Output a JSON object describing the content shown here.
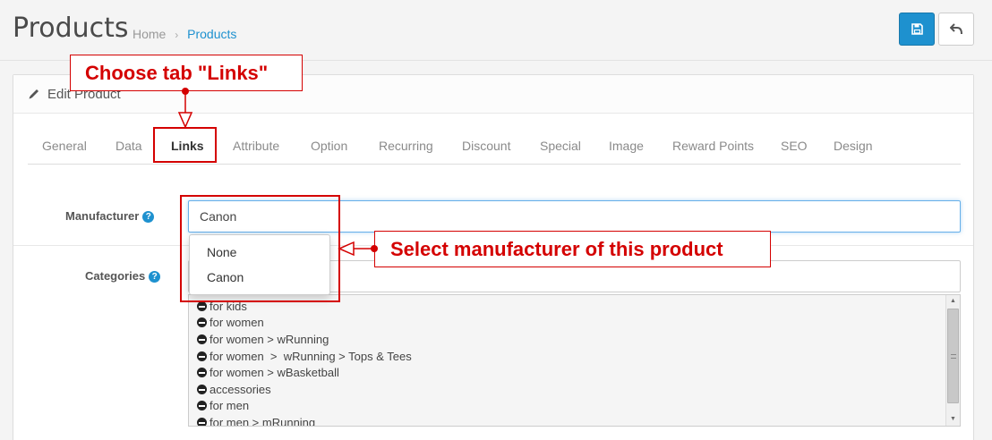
{
  "header": {
    "title": "Products",
    "breadcrumb": {
      "home": "Home",
      "separator": "›",
      "current": "Products"
    }
  },
  "panel": {
    "title": "Edit Product"
  },
  "tabs": [
    {
      "label": "General"
    },
    {
      "label": "Data"
    },
    {
      "label": "Links",
      "active": true
    },
    {
      "label": "Attribute"
    },
    {
      "label": "Option"
    },
    {
      "label": "Recurring"
    },
    {
      "label": "Discount"
    },
    {
      "label": "Special"
    },
    {
      "label": "Image"
    },
    {
      "label": "Reward Points"
    },
    {
      "label": "SEO"
    },
    {
      "label": "Design"
    }
  ],
  "form": {
    "manufacturer": {
      "label": "Manufacturer",
      "value": "Canon",
      "help": "?"
    },
    "categories": {
      "label": "Categories",
      "help": "?"
    },
    "manufacturer_options": [
      "None",
      "Canon"
    ],
    "category_items": [
      "for kids",
      "for women",
      "for women > wRunning",
      "for women  >  wRunning > Tops & Tees",
      "for women > wBasketball",
      "accessories",
      "for men",
      "for men > mRunning"
    ]
  },
  "annotations": {
    "choose_tab": "Choose tab \"Links\"",
    "select_manufacturer": "Select manufacturer of this product"
  },
  "colors": {
    "primary": "#1e91cf",
    "annotation_red": "#d40000"
  },
  "icons": {
    "save": "save-icon",
    "back": "reply-icon",
    "edit": "pencil-icon",
    "category_remove": "minus-circle-icon"
  }
}
